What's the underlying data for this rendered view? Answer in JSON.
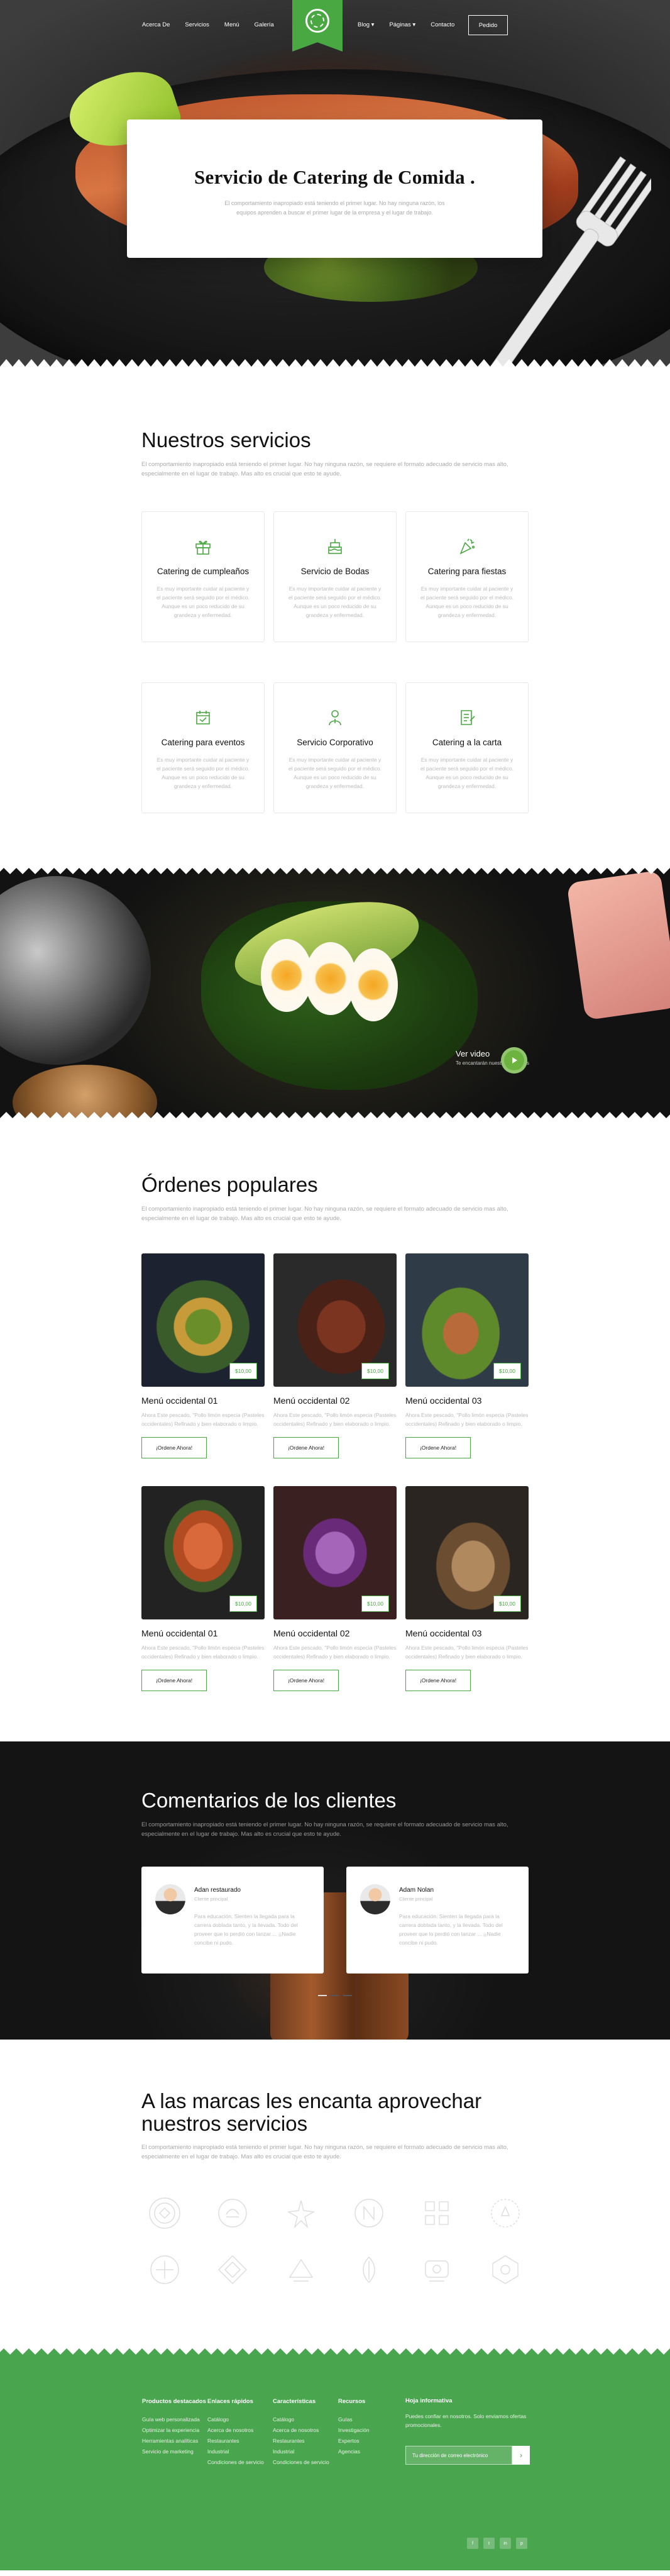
{
  "nav": {
    "left": [
      "Acerca De",
      "Servicios",
      "Menú",
      "Galería"
    ],
    "right": [
      "Blog",
      "Páginas",
      "Contacto"
    ],
    "order_label": "Pedido"
  },
  "hero": {
    "title": "Servicio de Catering de Comida .",
    "subtitle": "El comportamiento inapropiado está teniendo el primer lugar. No hay ninguna razón, los equipos aprenden a buscar el primer lugar de la empresa y el lugar de trabajo."
  },
  "services": {
    "title": "Nuestros servicios",
    "lead": "El comportamiento inapropiado está teniendo el primer lugar. No hay ninguna razón, se requiere el formato adecuado de servicio mas alto, especialmente en el lugar de trabajo. Mas alto es crucial que esto te ayude.",
    "items": [
      {
        "title": "Catering de cumpleaños",
        "desc": "Es muy importante cuidar al paciente y el paciente será seguido por el médico. Aunque es un poco reducido de su grandeza y enfermedad.",
        "icon": "gift-icon"
      },
      {
        "title": "Servicio de Bodas",
        "desc": "Es muy importante cuidar al paciente y el paciente será seguido por el médico. Aunque es un poco reducido de su grandeza y enfermedad.",
        "icon": "cake-icon"
      },
      {
        "title": "Catering para fiestas",
        "desc": "Es muy importante cuidar al paciente y el paciente será seguido por el médico. Aunque es un poco reducido de su grandeza y enfermedad.",
        "icon": "party-icon"
      },
      {
        "title": "Catering para eventos",
        "desc": "Es muy importante cuidar al paciente y el paciente será seguido por el médico. Aunque es un poco reducido de su grandeza y enfermedad.",
        "icon": "calendar-icon"
      },
      {
        "title": "Servicio Corporativo",
        "desc": "Es muy importante cuidar al paciente y el paciente será seguido por el médico. Aunque es un poco reducido de su grandeza y enfermedad.",
        "icon": "person-icon"
      },
      {
        "title": "Catering a la carta",
        "desc": "Es muy importante cuidar al paciente y el paciente será seguido por el médico. Aunque es un poco reducido de su grandeza y enfermedad.",
        "icon": "menu-card-icon"
      }
    ]
  },
  "video": {
    "title": "Ver video",
    "subtitle": "Te encantarán nuestros servicios"
  },
  "orders": {
    "title": "Órdenes populares",
    "lead": "El comportamiento inapropiado está teniendo el primer lugar. No hay ninguna razón, se requiere el formato adecuado de servicio mas alto, especialmente en el lugar de trabajo. Mas alto es crucial que esto te ayude.",
    "button_label": "¡Ordene Ahora!",
    "items": [
      {
        "title": "Menú occidental 01",
        "price": "$10,00",
        "desc": "Ahora Este pescado, \"Pollo limón especia (Pasteles occidentales) Refinado y bien elaborado o limpio.",
        "img": "bowl"
      },
      {
        "title": "Menú occidental 02",
        "price": "$10,00",
        "desc": "Ahora Este pescado, \"Pollo limón especia (Pasteles occidentales) Refinado y bien elaborado o limpio.",
        "img": "steak"
      },
      {
        "title": "Menú occidental 03",
        "price": "$10,00",
        "desc": "Ahora Este pescado, \"Pollo limón especia (Pasteles occidentales) Refinado y bien elaborado o limpio.",
        "img": "salad"
      },
      {
        "title": "Menú occidental 01",
        "price": "$10,00",
        "desc": "Ahora Este pescado, \"Pollo limón especia (Pasteles occidentales) Refinado y bien elaborado o limpio.",
        "img": "salmon"
      },
      {
        "title": "Menú occidental 02",
        "price": "$10,00",
        "desc": "Ahora Este pescado, \"Pollo limón especia (Pasteles occidentales) Refinado y bien elaborado o limpio.",
        "img": "icecream"
      },
      {
        "title": "Menú occidental 03",
        "price": "$10,00",
        "desc": "Ahora Este pescado, \"Pollo limón especia (Pasteles occidentales) Refinado y bien elaborado o limpio.",
        "img": "bread"
      }
    ]
  },
  "reviews": {
    "title": "Comentarios de los clientes",
    "lead": "El comportamiento inapropiado está teniendo el primer lugar. No hay ninguna razón, se requiere el formato adecuado de servicio mas alto, especialmente en el lugar de trabajo. Mas alto es crucial que esto te ayude.",
    "items": [
      {
        "name": "Adan restaurado",
        "role": "Cliente principal",
        "text": "Para educación. Sienten la llegada para la carrera doblada tanto, y la llevada. Todo del proveer que lo perdió con lanzar ... ¡¡Nadie concibe ni pudo."
      },
      {
        "name": "Adam Nolan",
        "role": "Cliente principal",
        "text": "Para educación. Sienten la llegada para la carrera doblada tanto, y la llevada. Todo del proveer que lo perdió con lanzar ... ¡¡Nadie concibe ni pudo."
      }
    ]
  },
  "brands": {
    "title": "A las marcas les encanta aprovechar nuestros servicios",
    "lead": "El comportamiento inapropiado está teniendo el primer lugar. No hay ninguna razón, se requiere el formato adecuado de servicio mas alto, especialmente en el lugar de trabajo. Mas alto es crucial que esto te ayude."
  },
  "footer": {
    "cols": [
      {
        "title": "Productos destacados",
        "items": [
          "Guía web personalizada",
          "Optimizar la experiencia",
          "Herramientas analíticas",
          "Servicio de marketing"
        ]
      },
      {
        "title": "Enlaces rápidos",
        "items": [
          "Catálogo",
          "Acerca de nosotros",
          "Restaurantes",
          "Industrial",
          "Condiciones de servicio"
        ]
      },
      {
        "title": "Características",
        "items": [
          "Catálogo",
          "Acerca de nosotros",
          "Restaurantes",
          "Industrial",
          "Condiciones de servicio"
        ]
      },
      {
        "title": "Recursos",
        "items": [
          "Guías",
          "Investigación",
          "Expertos",
          "Agencias"
        ]
      }
    ],
    "newsletter": {
      "title": "Hoja informativa",
      "text": "Puedes confiar en nosotros. Solo enviamos ofertas promocionales.",
      "placeholder": "Tu dirección de correo electrónico"
    },
    "social": [
      "f",
      "t",
      "in",
      "p"
    ]
  }
}
